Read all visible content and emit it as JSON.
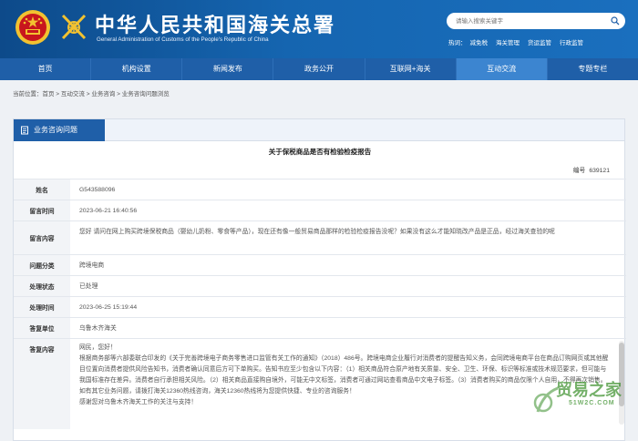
{
  "header": {
    "title_cn": "中华人民共和国海关总署",
    "title_en": "General Administration of Customs of the People's Republic of China",
    "search_placeholder": "请输入搜索关键字",
    "hot_label": "热词：",
    "hot_words": [
      "减免税",
      "海关管理",
      "货运监管",
      "行政监管"
    ]
  },
  "nav": {
    "items": [
      "首页",
      "机构设置",
      "新闻发布",
      "政务公开",
      "互联网+海关",
      "互动交流",
      "专题专栏"
    ],
    "active_index": 5
  },
  "breadcrumb": {
    "prefix": "当前位置：",
    "path": "首页 > 互动交流 > 业务咨询 > 业务咨询问题浏览"
  },
  "panel": {
    "tab_label": "业务咨询问题",
    "doc_title": "关于保税商品是否有检验检疫报告",
    "doc_no_label": "编号",
    "doc_no_value": "639121"
  },
  "fields": [
    {
      "label": "姓名",
      "value": "G543588096"
    },
    {
      "label": "留言时间",
      "value": "2023-06-21 16:40:56"
    },
    {
      "label": "留言内容",
      "value": "您好 请问在网上购买跨境保税商品（婴幼儿奶粉、零食等产品），现在还有像一般贸易商品那样的检验检疫报告没呢？如果没有这么才能知晓改产品是正品，经过海关查验的呢"
    },
    {
      "label": "问题分类",
      "value": "跨境电商"
    },
    {
      "label": "处理状态",
      "value": "已处理"
    },
    {
      "label": "处理时间",
      "value": "2023-06-25 15:19:44"
    },
    {
      "label": "答复单位",
      "value": "乌鲁木齐海关"
    }
  ],
  "reply": {
    "label": "答复内容",
    "lines": [
      "网民，您好！",
      "根据商务部等六部委联合印发的《关于完善跨境电子商务零售进口监管有关工作的通知》（2018）486号。跨境电商企业履行对消费者的提醒告知义务，会同跨境电商平台在商品订购网页或其他醒目位置向消费者提供风险告知书，消费者确认同意后方可下单购买。告知书应至少包含以下内容：（1）相关商品符合原产地有关质量、安全、卫生、环保、标识等标准或技术规范要求，但可能与我国标准存在差异。消费者自行承担相关风险。（2）相关商品直接购自境外，可能无中文标签，消费者可通过网站查看商品中文电子标签。（3）消费者购买的商品仅限个人自用，不得再次销售。",
      "如有其它业务问题，请拨打海关12360热线咨询，海关12360热线将为您提供快捷、专业的咨询服务！",
      "感谢您对乌鲁木齐海关工作的关注与支持！"
    ]
  },
  "watermark": {
    "text": "贸易之家",
    "sub": "51W2C.COM"
  },
  "colors": {
    "header_bg": "#1565b0",
    "nav_bg": "#1f5fa8",
    "nav_active": "#3c85d0",
    "emblem_red": "#c8161d",
    "emblem_gold": "#f2c230"
  }
}
